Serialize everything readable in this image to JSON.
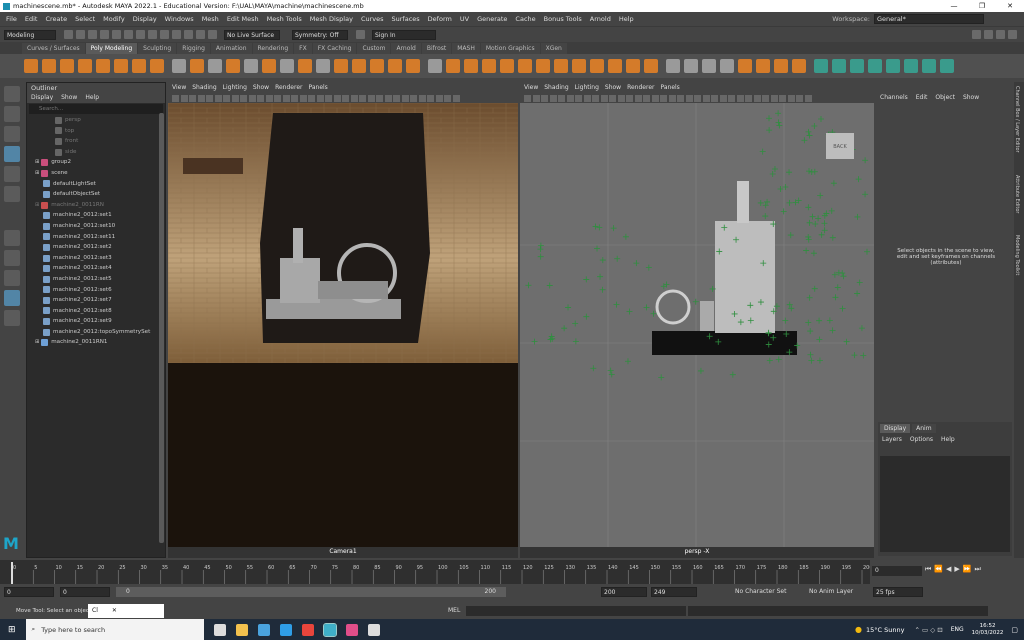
{
  "window": {
    "title": "machinescene.mb* - Autodesk MAYA 2022.1 - Educational Version: F:\\UAL\\MAYA\\machine\\machinescene.mb",
    "min": "—",
    "max": "❐",
    "close": "✕"
  },
  "menubar": [
    "File",
    "Edit",
    "Create",
    "Select",
    "Modify",
    "Display",
    "Windows",
    "Mesh",
    "Edit Mesh",
    "Mesh Tools",
    "Mesh Display",
    "Curves",
    "Surfaces",
    "Deform",
    "UV",
    "Generate",
    "Cache",
    "Bonus Tools",
    "Arnold",
    "Help"
  ],
  "workspace": {
    "label": "Workspace:",
    "value": "General*"
  },
  "statusline": {
    "mode": "Modeling",
    "live_surface": "No Live Surface",
    "symmetry": "Symmetry: Off",
    "sign_in": "Sign In"
  },
  "shelf_tabs": [
    "Curves / Surfaces",
    "Poly Modeling",
    "Sculpting",
    "Rigging",
    "Animation",
    "Rendering",
    "FX",
    "FX Caching",
    "Custom",
    "Arnold",
    "Bifrost",
    "MASH",
    "Motion Graphics",
    "XGen"
  ],
  "active_shelf_tab": "Poly Modeling",
  "outliner": {
    "title": "Outliner",
    "menu": [
      "Display",
      "Show",
      "Help"
    ],
    "search_placeholder": "Search...",
    "items": [
      {
        "label": "persp",
        "kind": "cam",
        "dim": true
      },
      {
        "label": "top",
        "kind": "cam",
        "dim": true
      },
      {
        "label": "front",
        "kind": "cam",
        "dim": true
      },
      {
        "label": "side",
        "kind": "cam",
        "dim": true
      },
      {
        "label": "group2",
        "kind": "group",
        "dim": false
      },
      {
        "label": "scene",
        "kind": "group",
        "dim": false
      },
      {
        "label": "defaultLightSet",
        "kind": "set",
        "dim": false
      },
      {
        "label": "defaultObjectSet",
        "kind": "set",
        "dim": false
      },
      {
        "label": "machine2_0011RN",
        "kind": "ref",
        "dim": true
      },
      {
        "label": "machine2_0012:set1",
        "kind": "set",
        "dim": false
      },
      {
        "label": "machine2_0012:set10",
        "kind": "set",
        "dim": false
      },
      {
        "label": "machine2_0012:set11",
        "kind": "set",
        "dim": false
      },
      {
        "label": "machine2_0012:set2",
        "kind": "set",
        "dim": false
      },
      {
        "label": "machine2_0012:set3",
        "kind": "set",
        "dim": false
      },
      {
        "label": "machine2_0012:set4",
        "kind": "set",
        "dim": false
      },
      {
        "label": "machine2_0012:set5",
        "kind": "set",
        "dim": false
      },
      {
        "label": "machine2_0012:set6",
        "kind": "set",
        "dim": false
      },
      {
        "label": "machine2_0012:set7",
        "kind": "set",
        "dim": false
      },
      {
        "label": "machine2_0012:set8",
        "kind": "set",
        "dim": false
      },
      {
        "label": "machine2_0012:set9",
        "kind": "set",
        "dim": false
      },
      {
        "label": "machine2_0012:topoSymmetrySet",
        "kind": "set",
        "dim": false
      },
      {
        "label": "machine2_0011RN1",
        "kind": "ref2",
        "dim": false
      }
    ]
  },
  "viewport_menu": [
    "View",
    "Shading",
    "Lighting",
    "Show",
    "Renderer",
    "Panels"
  ],
  "viewport1": {
    "label": "Camera1"
  },
  "viewport2": {
    "label": "persp -X",
    "cube": "BACK"
  },
  "channel_box": {
    "menu": [
      "Channels",
      "Edit",
      "Object",
      "Show"
    ],
    "message": "Select objects in the scene to view, edit and set keyframes on channels (attributes)",
    "layer_tabs": [
      "Display",
      "Anim"
    ],
    "layer_menu": [
      "Layers",
      "Options",
      "Help"
    ],
    "side_tabs": [
      "Channel Box / Layer Editor",
      "Attribute Editor",
      "Modeling Toolkit"
    ]
  },
  "timeline": {
    "ticks": [
      "0",
      "5",
      "10",
      "15",
      "20",
      "25",
      "30",
      "35",
      "40",
      "45",
      "50",
      "55",
      "60",
      "65",
      "70",
      "75",
      "80",
      "85",
      "90",
      "95",
      "100",
      "105",
      "110",
      "115",
      "120",
      "125",
      "130",
      "135",
      "140",
      "145",
      "150",
      "155",
      "160",
      "165",
      "170",
      "175",
      "180",
      "185",
      "190",
      "195",
      "200"
    ],
    "current": "0"
  },
  "range": {
    "start": "0",
    "start2": "0",
    "slider_start": "0",
    "slider_end": "200",
    "end": "200",
    "end2": "249",
    "character_set": "No Character Set",
    "anim_layer": "No Anim Layer",
    "fps": "25 fps"
  },
  "command": {
    "help": "Move Tool: Select an object t",
    "popup": "Cl",
    "mel": "MEL"
  },
  "taskbar": {
    "search": "Type here to search",
    "weather": "15°C  Sunny",
    "lang": "ENG",
    "time": "16:52",
    "date": "10/03/2022"
  }
}
